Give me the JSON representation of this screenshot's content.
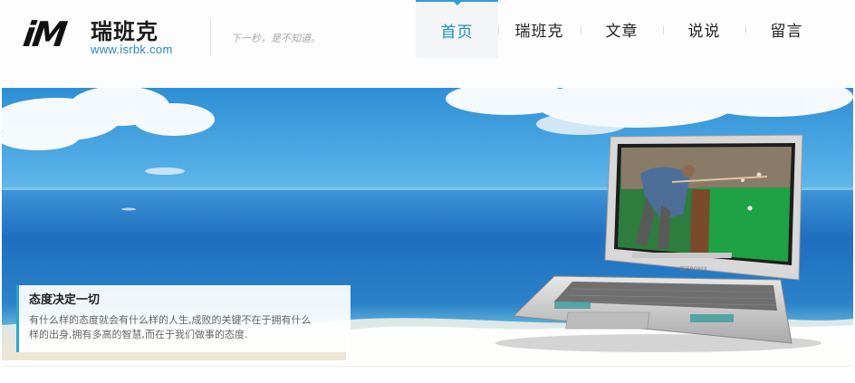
{
  "site": {
    "logo_mark": "iM",
    "logo_name": "瑞班克",
    "logo_url": "www.isrbk.com",
    "slogan": "下一秒，是不知道。"
  },
  "nav": {
    "items": [
      {
        "label": "首页",
        "active": true
      },
      {
        "label": "瑞班克",
        "active": false
      },
      {
        "label": "文章",
        "active": false
      },
      {
        "label": "说说",
        "active": false
      },
      {
        "label": "留言",
        "active": false
      }
    ]
  },
  "banner": {
    "laptop_brand": "ZETRONIX",
    "caption": {
      "title": "态度决定一切",
      "text_line1": "有什么样的态度就会有什么样的人生,成败的关键不在于拥有什么",
      "text_line2": "样的出身,拥有多高的智慧,而在于我们做事的态度."
    }
  },
  "colors": {
    "accent": "#1a8ec4",
    "caption_bar": "#26a4d8",
    "sky": "#2e8fd6",
    "sea": "#1f6fbf"
  }
}
